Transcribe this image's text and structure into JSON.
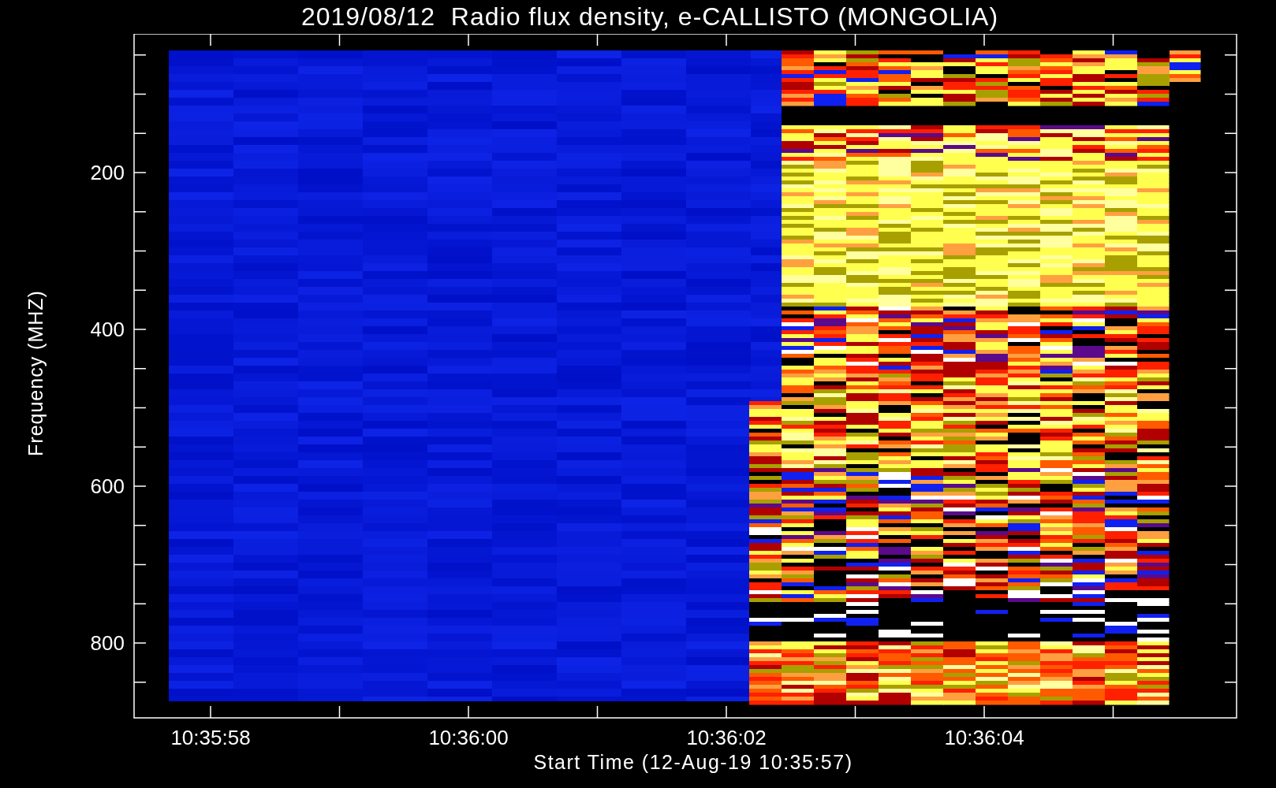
{
  "title": "2019/08/12  Radio flux density, e-CALLISTO (MONGOLIA)",
  "y_axis": {
    "label": "Frequency (MHZ)",
    "tick_labels": [
      "200",
      "400",
      "600",
      "800"
    ]
  },
  "x_axis": {
    "label": "Start Time (12-Aug-19 10:35:57)",
    "tick_labels": [
      "10:35:58",
      "10:36:00",
      "10:36:02",
      "10:36:04"
    ]
  }
}
